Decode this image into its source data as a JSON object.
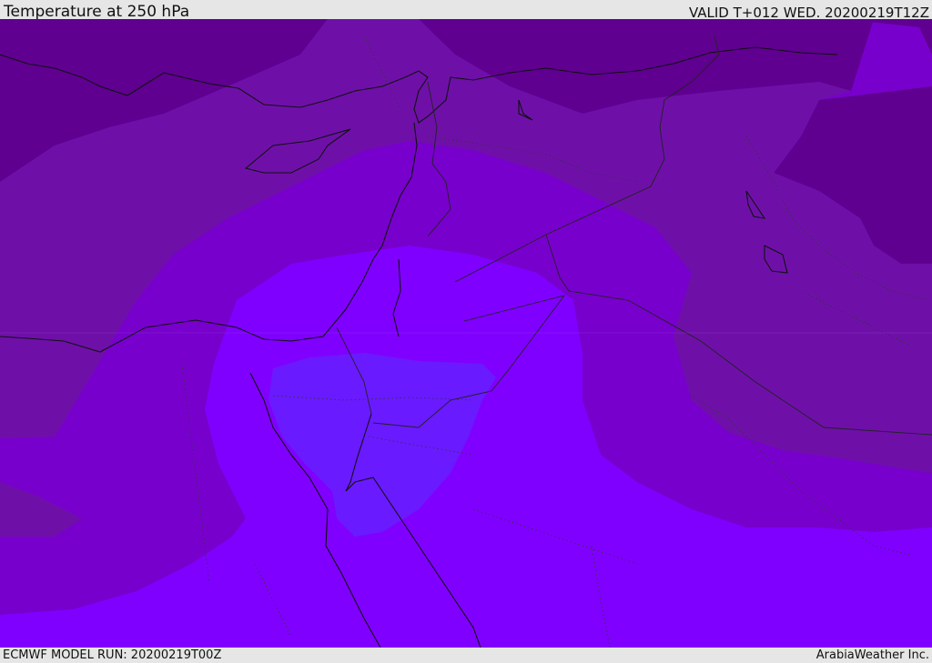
{
  "header": {
    "title": "Temperature at 250 hPa",
    "valid": "VALID T+012 WED. 20200219T12Z"
  },
  "footer": {
    "model_run": "ECMWF MODEL RUN: 20200219T00Z",
    "credit": "ArabiaWeather Inc."
  },
  "colors": {
    "band_coldest": "#5f0090",
    "band_cold": "#6e10a8",
    "band_mid": "#7800cc",
    "band_warm": "#8000ff",
    "band_warmest": "#6a1aff",
    "coast": "#111111",
    "border": "#222222"
  }
}
